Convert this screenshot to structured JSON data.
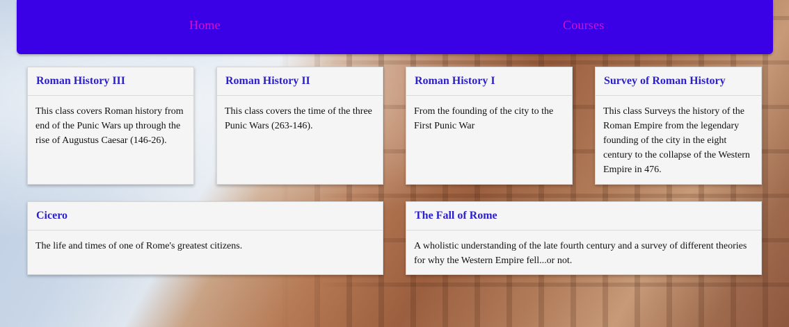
{
  "nav": {
    "home_label": "Home",
    "courses_label": "Courses",
    "bar_color": "#3a00e6",
    "link_color": "#d011d0"
  },
  "courses": [
    {
      "title": "Roman History III",
      "description": "This class covers Roman history from end of the Punic Wars up through the rise of Augustus Caesar (146-26)."
    },
    {
      "title": "Roman History II",
      "description": "This class covers the time of the three Punic Wars (263-146)."
    },
    {
      "title": "Roman History I",
      "description": "From the founding of the city to the First Punic War"
    },
    {
      "title": "Survey of Roman History",
      "description": "This class Surveys the history of the Roman Empire from the legendary founding of the city in the eight century to the collapse of the Western Empire in 476."
    },
    {
      "title": "Cicero",
      "description": "The life and times of one of Rome's greatest citizens."
    },
    {
      "title": "The Fall of Rome",
      "description": "A wholistic understanding of the late fourth century and a survey of different theories for why the Western Empire fell...or not."
    }
  ],
  "background": {
    "subject": "colosseum-photo"
  }
}
